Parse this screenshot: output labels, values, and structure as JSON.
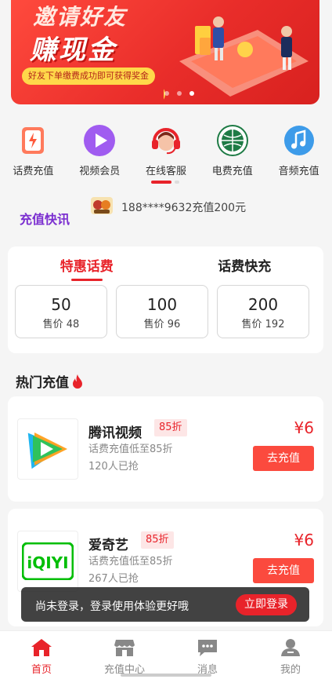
{
  "banner": {
    "headline_top": "邀请好友",
    "headline_main": "赚现金",
    "promo": "好友下单缴费成功即可获得奖金"
  },
  "quick_menu": [
    {
      "label": "话费充值",
      "icon": "phone-recharge-icon",
      "color": "#ff6a4d"
    },
    {
      "label": "视频会员",
      "icon": "play-icon",
      "color": "#a05cf0"
    },
    {
      "label": "在线客服",
      "icon": "customer-service-icon",
      "color": "#e8232a"
    },
    {
      "label": "电费充值",
      "icon": "state-grid-icon",
      "color": "#1e7b45"
    },
    {
      "label": "音频充值",
      "icon": "music-icon",
      "color": "#3d9be9"
    }
  ],
  "news": {
    "title": "充值快讯",
    "message": "188****9632充值200元"
  },
  "phone_recharge": {
    "tabs": [
      "特惠话费",
      "话费快充"
    ],
    "active_tab": 0,
    "options": [
      {
        "value": "50",
        "price": "售价 48"
      },
      {
        "value": "100",
        "price": "售价 96"
      },
      {
        "value": "200",
        "price": "售价 192"
      }
    ]
  },
  "hot": {
    "title": "热门充值",
    "products": [
      {
        "name": "腾讯视频",
        "badge": "85折",
        "desc": "话费充值低至85折",
        "sold": "120人已抢",
        "price": "¥6",
        "button": "去充值"
      },
      {
        "name": "爱奇艺",
        "badge": "85折",
        "desc": "话费充值低至85折",
        "sold": "267人已抢",
        "price": "¥6",
        "button": "去充值"
      }
    ]
  },
  "toast": {
    "message": "尚未登录，登录使用体验更好哦",
    "button": "立即登录"
  },
  "bottom_nav": [
    {
      "label": "首页",
      "icon": "home-icon",
      "active": true
    },
    {
      "label": "充值中心",
      "icon": "store-icon",
      "active": false
    },
    {
      "label": "消息",
      "icon": "message-icon",
      "active": false
    },
    {
      "label": "我的",
      "icon": "profile-icon",
      "active": false
    }
  ],
  "colors": {
    "accent": "#e8232a",
    "news_title": "#7b2fd0",
    "button": "#fb4a3e"
  }
}
